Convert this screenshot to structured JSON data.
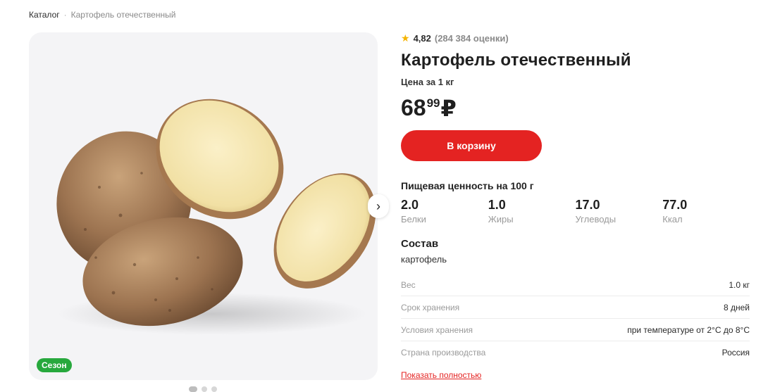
{
  "breadcrumbs": [
    "Каталог",
    "Картофель отечественный"
  ],
  "breadcrumb_separator": "·",
  "gallery": {
    "badge": "Сезон",
    "dots_count": 3,
    "active_dot": 0
  },
  "rating": {
    "value": "4,82",
    "count": "(284 384 оценки)"
  },
  "product": {
    "title": "Картофель отечественный",
    "unit_label": "Цена за 1 кг",
    "price_rub": "68",
    "price_kop": "99",
    "currency": "₽"
  },
  "cart_button": "В корзину",
  "nutrition": {
    "title": "Пищевая ценность на 100 г",
    "items": [
      {
        "value": "2.0",
        "label": "Белки"
      },
      {
        "value": "1.0",
        "label": "Жиры"
      },
      {
        "value": "17.0",
        "label": "Углеводы"
      },
      {
        "value": "77.0",
        "label": "Ккал"
      }
    ]
  },
  "composition": {
    "title": "Состав",
    "value": "картофель"
  },
  "properties": [
    {
      "key": "Вес",
      "value": "1.0 кг"
    },
    {
      "key": "Срок хранения",
      "value": "8 дней"
    },
    {
      "key": "Условия хранения",
      "value": "при температуре от 2°С до 8°С"
    },
    {
      "key": "Страна производства",
      "value": "Россия"
    }
  ],
  "show_more": "Показать полностью",
  "colors": {
    "accent": "#e42322",
    "badge": "#27a83d",
    "star": "#f5b400"
  },
  "icons": {
    "rating": "star-icon",
    "next": "chevron-right-icon"
  }
}
